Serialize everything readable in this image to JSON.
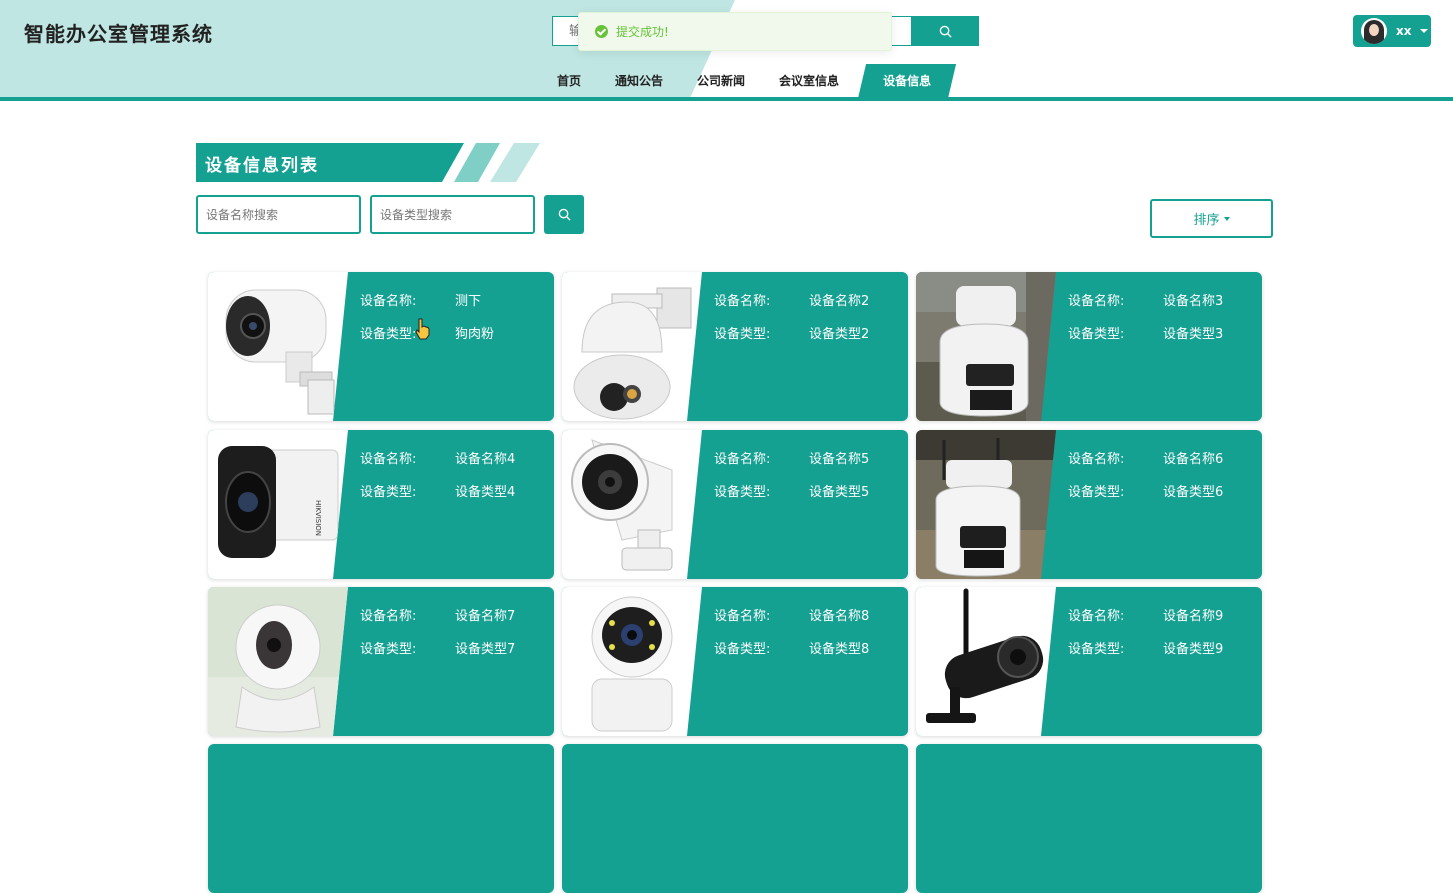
{
  "app": {
    "title": "智能办公室管理系统"
  },
  "search": {
    "placeholder": "输入关键字搜索"
  },
  "toast": {
    "message": "提交成功!"
  },
  "user": {
    "name": "xx"
  },
  "nav": {
    "items": [
      {
        "label": "首页"
      },
      {
        "label": "通知公告"
      },
      {
        "label": "公司新闻"
      },
      {
        "label": "会议室信息"
      },
      {
        "label": "设备信息",
        "active": true
      }
    ]
  },
  "section": {
    "title": "设备信息列表"
  },
  "filters": {
    "name_placeholder": "设备名称搜索",
    "type_placeholder": "设备类型搜索",
    "sort_label": "排序"
  },
  "labels": {
    "name": "设备名称:",
    "type": "设备类型:"
  },
  "devices": [
    {
      "name": "测下",
      "type": "狗肉粉",
      "image": "bullet-camera-white"
    },
    {
      "name": "设备名称2",
      "type": "设备类型2",
      "image": "ptz-dome-camera"
    },
    {
      "name": "设备名称3",
      "type": "设备类型3",
      "image": "outdoor-ptz-camera-photo"
    },
    {
      "name": "设备名称4",
      "type": "设备类型4",
      "image": "bullet-camera-hikvision"
    },
    {
      "name": "设备名称5",
      "type": "设备类型5",
      "image": "ir-bullet-camera"
    },
    {
      "name": "设备名称6",
      "type": "设备类型6",
      "image": "outdoor-ptz-camera-photo"
    },
    {
      "name": "设备名称7",
      "type": "设备类型7",
      "image": "indoor-dome-camera"
    },
    {
      "name": "设备名称8",
      "type": "设备类型8",
      "image": "indoor-ptz-camera"
    },
    {
      "name": "设备名称9",
      "type": "设备类型9",
      "image": "wifi-bullet-camera-black"
    }
  ],
  "colors": {
    "primary": "#14a192",
    "header_bg": "#bfe6e2",
    "success": "#67c23a"
  }
}
